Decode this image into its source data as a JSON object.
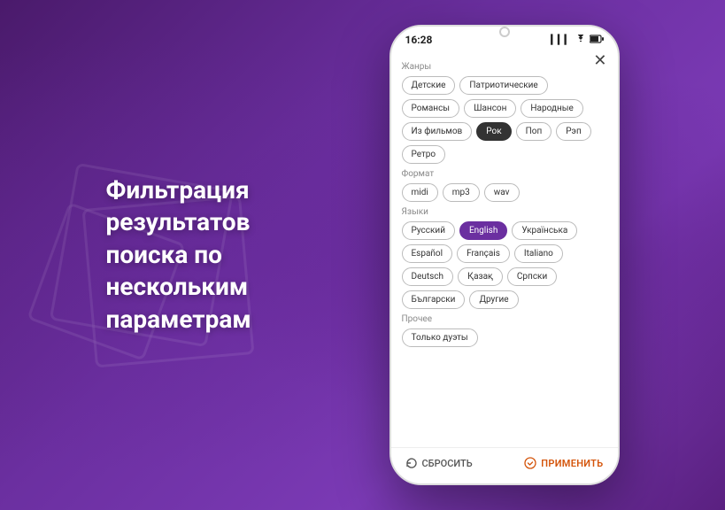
{
  "background": {
    "color_start": "#4a1a6b",
    "color_end": "#5a2080"
  },
  "left_section": {
    "title": "Фильтрация результатов поиска по нескольким параметрам"
  },
  "phone": {
    "status_bar": {
      "time": "16:28",
      "signal": "▎▎▎",
      "wifi": "wifi",
      "battery": "battery"
    },
    "close_button": "✕",
    "sections": [
      {
        "id": "genres",
        "label": "Жанры",
        "tags": [
          {
            "text": "Детские",
            "active": false
          },
          {
            "text": "Патриотические",
            "active": false
          },
          {
            "text": "Романсы",
            "active": false
          },
          {
            "text": "Шансон",
            "active": false
          },
          {
            "text": "Народные",
            "active": false
          },
          {
            "text": "Из фильмов",
            "active": false
          },
          {
            "text": "Рок",
            "active": true
          },
          {
            "text": "Поп",
            "active": false
          },
          {
            "text": "Рэп",
            "active": false
          },
          {
            "text": "Ретро",
            "active": false
          }
        ]
      },
      {
        "id": "format",
        "label": "Формат",
        "tags": [
          {
            "text": "midi",
            "active": false
          },
          {
            "text": "mp3",
            "active": false
          },
          {
            "text": "wav",
            "active": false
          }
        ]
      },
      {
        "id": "languages",
        "label": "Языки",
        "tags": [
          {
            "text": "Русский",
            "active": false
          },
          {
            "text": "English",
            "active": true,
            "style": "purple"
          },
          {
            "text": "Українська",
            "active": false
          },
          {
            "text": "Español",
            "active": false
          },
          {
            "text": "Français",
            "active": false
          },
          {
            "text": "Italiano",
            "active": false
          },
          {
            "text": "Deutsch",
            "active": false
          },
          {
            "text": "Қазақ",
            "active": false
          },
          {
            "text": "Српски",
            "active": false
          },
          {
            "text": "Български",
            "active": false
          },
          {
            "text": "Другие",
            "active": false
          }
        ]
      },
      {
        "id": "other",
        "label": "Прочее",
        "tags": [
          {
            "text": "Только дуэты",
            "active": false
          }
        ]
      }
    ],
    "footer": {
      "reset_label": "СБРОСИТЬ",
      "apply_label": "ПРИМЕНИТЬ"
    }
  }
}
